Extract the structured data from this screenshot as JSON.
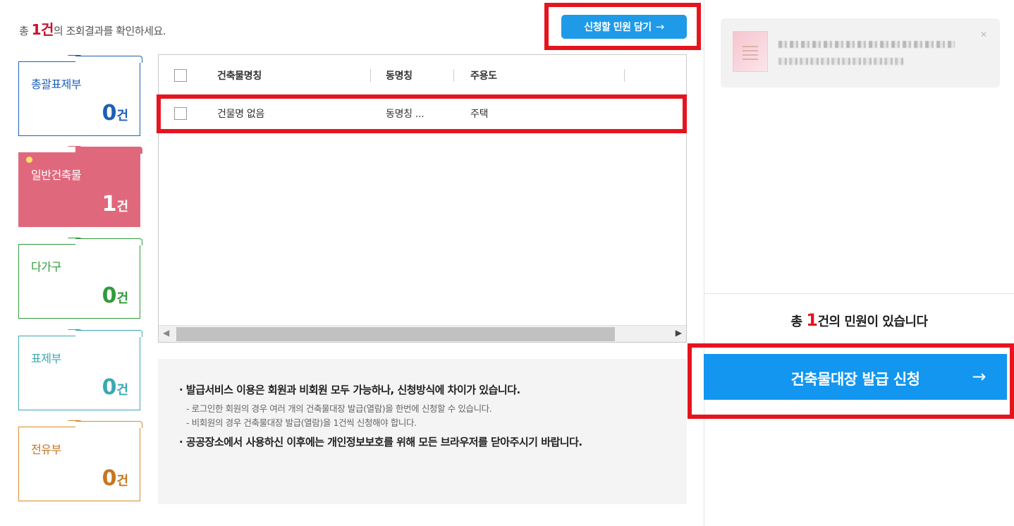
{
  "summary": {
    "prefix": "총 ",
    "count": "1건",
    "suffix": "의 조회결과를 확인하세요."
  },
  "cart_button": {
    "label": "신청할 민원 담기",
    "arrow": "→"
  },
  "categories": [
    {
      "name": "총괄표제부",
      "count": "0",
      "unit": "건"
    },
    {
      "name": "일반건축물",
      "count": "1",
      "unit": "건"
    },
    {
      "name": "다가구",
      "count": "0",
      "unit": "건"
    },
    {
      "name": "표제부",
      "count": "0",
      "unit": "건"
    },
    {
      "name": "전유부",
      "count": "0",
      "unit": "건"
    }
  ],
  "grid": {
    "columns": [
      "건축물명칭",
      "동명칭",
      "주용도"
    ],
    "rows": [
      {
        "name": "건물명 없음",
        "dong": "동명칭 ...",
        "use": "주택"
      }
    ]
  },
  "notice": {
    "line1": "· 발급서비스 이용은 회원과 비회원 모두 가능하나, 신청방식에 차이가 있습니다.",
    "line2": "- 로그인한 회원의 경우 여러 개의 건축물대장 발급(열람)을 한번에 신청할 수 있습니다.",
    "line3": "- 비회원의 경우 건축물대장 발급(열람)을 1건씩 신청해야 합니다.",
    "line4": "· 공공장소에서 사용하신 이후에는 개인정보보호를 위해 모든 브라우저를 닫아주시기 바랍니다."
  },
  "right_panel": {
    "count_prefix": "총 ",
    "count_value": "1",
    "count_suffix": "건의 민원이 있습니다",
    "issue_button": "건축물대장 발급 신청",
    "issue_arrow": "→"
  },
  "colors": {
    "accent_blue": "#1296f0",
    "highlight_red": "#e5141e",
    "card_pink": "#e0687d"
  }
}
